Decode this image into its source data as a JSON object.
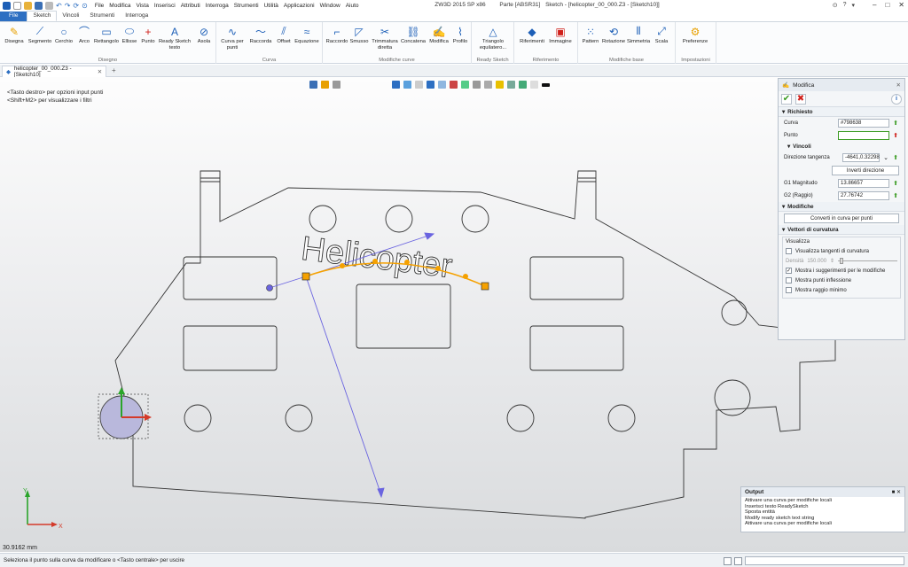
{
  "window": {
    "app": "ZW3D 2015 SP x86",
    "part": "Parte [ABSR31]",
    "file_title": "Sketch - [helicopter_00_000.Z3 - [Sketch10]]"
  },
  "menu": [
    "File",
    "Modifica",
    "Vista",
    "Inserisci",
    "Attributi",
    "Interroga",
    "Strumenti",
    "Utilità",
    "Applicazioni",
    "Window",
    "Aiuto"
  ],
  "ribbon_tabs": [
    "File",
    "Sketch",
    "Vincoli",
    "Strumenti",
    "Interroga"
  ],
  "ribbon": {
    "groups": [
      {
        "label": "Disegno",
        "buttons": [
          {
            "label": "Disegna",
            "icon": "draw-pencil-icon"
          },
          {
            "label": "Segmento",
            "icon": "segment-icon"
          },
          {
            "label": "Cerchio",
            "icon": "circle-icon"
          },
          {
            "label": "Arco",
            "icon": "arc-icon"
          },
          {
            "label": "Rettangolo",
            "icon": "rectangle-icon"
          },
          {
            "label": "Ellisse",
            "icon": "ellipse-icon"
          },
          {
            "label": "Punto",
            "icon": "point-icon"
          },
          {
            "label": "Ready Sketch\ntesto",
            "icon": "text-icon"
          },
          {
            "label": "Asola",
            "icon": "slot-icon"
          }
        ]
      },
      {
        "label": "Curva",
        "buttons": [
          {
            "label": "Curva per\npunti",
            "icon": "curve-points-icon"
          },
          {
            "label": "Raccorda",
            "icon": "blend-icon"
          },
          {
            "label": "Offset",
            "icon": "offset-icon"
          },
          {
            "label": "Equazione",
            "icon": "equation-icon"
          }
        ]
      },
      {
        "label": "Modifiche curve",
        "buttons": [
          {
            "label": "Raccordo",
            "icon": "fillet-icon"
          },
          {
            "label": "Smusso",
            "icon": "chamfer-icon"
          },
          {
            "label": "Trimmatura\ndiretta",
            "icon": "trim-icon"
          },
          {
            "label": "Concatena",
            "icon": "chain-icon"
          },
          {
            "label": "Modifica",
            "icon": "modify-icon"
          },
          {
            "label": "Profilo",
            "icon": "profile-icon"
          }
        ]
      },
      {
        "label": "Ready Sketch",
        "buttons": [
          {
            "label": "Triangolo\nequilatero...",
            "icon": "triangle-icon"
          }
        ]
      },
      {
        "label": "Riferimento",
        "buttons": [
          {
            "label": "Riferimenti",
            "icon": "reference-icon"
          },
          {
            "label": "Immagine",
            "icon": "image-icon"
          }
        ]
      },
      {
        "label": "Modifiche base",
        "buttons": [
          {
            "label": "Pattern",
            "icon": "pattern-icon"
          },
          {
            "label": "Rotazione",
            "icon": "rotate-icon"
          },
          {
            "label": "Simmetria",
            "icon": "mirror-icon"
          },
          {
            "label": "Scala",
            "icon": "scale-icon"
          }
        ]
      },
      {
        "label": "Impostazioni",
        "buttons": [
          {
            "label": "Preferenze",
            "icon": "preferences-icon"
          }
        ]
      }
    ]
  },
  "doc_tab": {
    "label": "helicopter_00_000.Z3 - [Sketch10]"
  },
  "hints": [
    "<Tasto destro> per opzioni input punti",
    "<Shift+M2> per visualizzare i filtri"
  ],
  "canvas": {
    "helicopter_text": "Helicopter",
    "measurement": "30.9162 mm",
    "axis_x": "X",
    "axis_y": "Y"
  },
  "panel": {
    "title": "Modifica",
    "sections": {
      "required": "Richiesto",
      "constraints": "Vincoli",
      "modifications": "Modifiche",
      "curvature": "Vettori di curvatura"
    },
    "curva_label": "Curva",
    "curva_value": "#798638",
    "punto_label": "Punto",
    "punto_value": "",
    "dir_label": "Direzione tangenza",
    "dir_value": "-4641,0.32298",
    "invert_btn": "Inverti direzione",
    "g1_label": "G1 Magnitudo",
    "g1_value": "13.86657",
    "g2_label": "G2 (Raggio)",
    "g2_value": "27.76742",
    "convert_btn": "Converti in curva per punti",
    "visualizza": "Visualizza",
    "chk_tangent": "Visualizza tangenti di curvatura",
    "density_label": "Densità",
    "density_value": "150.000",
    "chk_suggest": "Mostra i suggerimenti per le modifiche",
    "chk_inflection": "Mostra punti inflessione",
    "chk_minradius": "Mostra raggio minimo",
    "checks": {
      "tangent": false,
      "suggest": true,
      "inflection": false,
      "minradius": false
    }
  },
  "output": {
    "title": "Output",
    "lines": [
      "Attivare una curva per modifiche locali",
      "Inserisci testo ReadySketch",
      "Sposta entità",
      "Modify ready sketch text string",
      "Attivare una curva per modifiche locali"
    ]
  },
  "status": {
    "text": "Seleziona il punto sulla curva da modificare o <Tasto centrale> per uscire"
  },
  "colors": {
    "accent": "#2d6fc2",
    "curve": "#f5a100",
    "vector": "#6a64e0",
    "ok": "#3a9b22",
    "cancel": "#d0201a"
  }
}
